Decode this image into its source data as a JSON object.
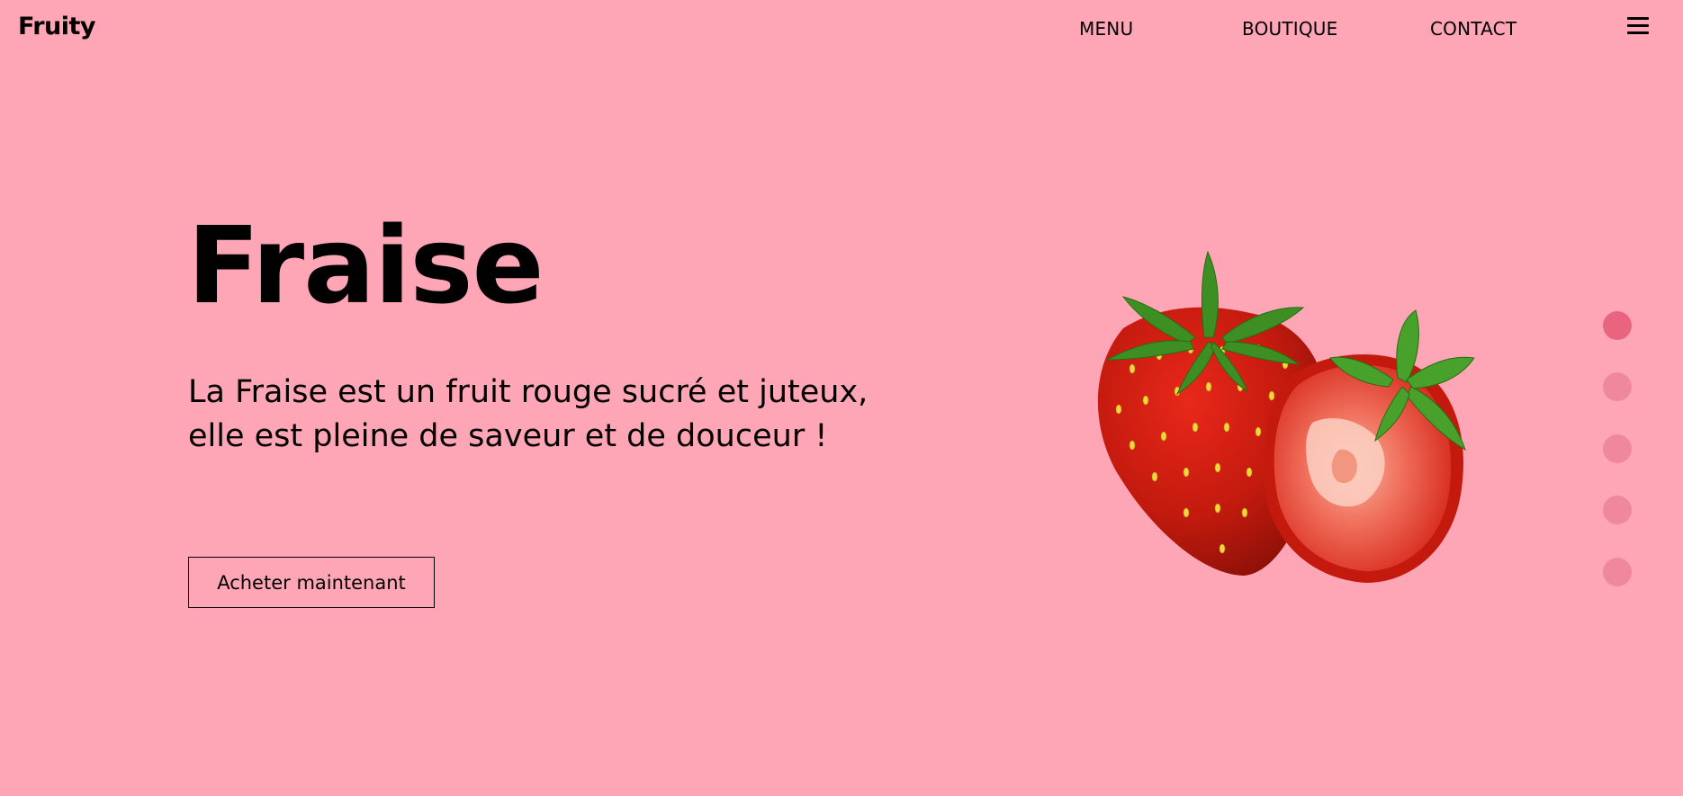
{
  "header": {
    "logo": "Fruity",
    "nav": {
      "menu": "MENU",
      "boutique": "BOUTIQUE",
      "contact": "CONTACT"
    },
    "menu_icon": "hamburger-icon"
  },
  "hero": {
    "title": "Fraise",
    "description": "La Fraise est un fruit rouge sucré et juteux, elle est pleine de saveur et de douceur !",
    "cta_label": "Acheter maintenant",
    "image": "strawberry-illustration"
  },
  "slider": {
    "count": 5,
    "active_index": 0
  },
  "colors": {
    "background": "#ffa6b6",
    "dot_active": "#e9657f",
    "dot_inactive": "#ef889d",
    "text": "#000000"
  }
}
